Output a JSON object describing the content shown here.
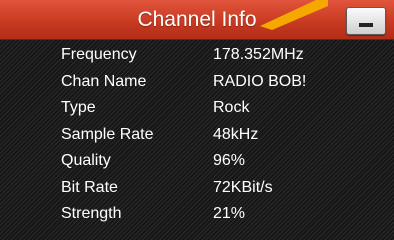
{
  "header": {
    "title": "Channel Info",
    "minimize_icon": "minimize-icon",
    "pointer_icon": "pointer-arrow-icon",
    "accent_color": "#c93a22",
    "pointer_color": "#f5a800"
  },
  "info": {
    "rows": [
      {
        "label": "Frequency",
        "value": "178.352MHz"
      },
      {
        "label": "Chan Name",
        "value": "RADIO BOB!"
      },
      {
        "label": "Type",
        "value": "Rock"
      },
      {
        "label": "Sample Rate",
        "value": "48kHz"
      },
      {
        "label": "Quality",
        "value": "96%"
      },
      {
        "label": "Bit Rate",
        "value": "72KBit/s"
      },
      {
        "label": "Strength",
        "value": "21%"
      }
    ]
  }
}
